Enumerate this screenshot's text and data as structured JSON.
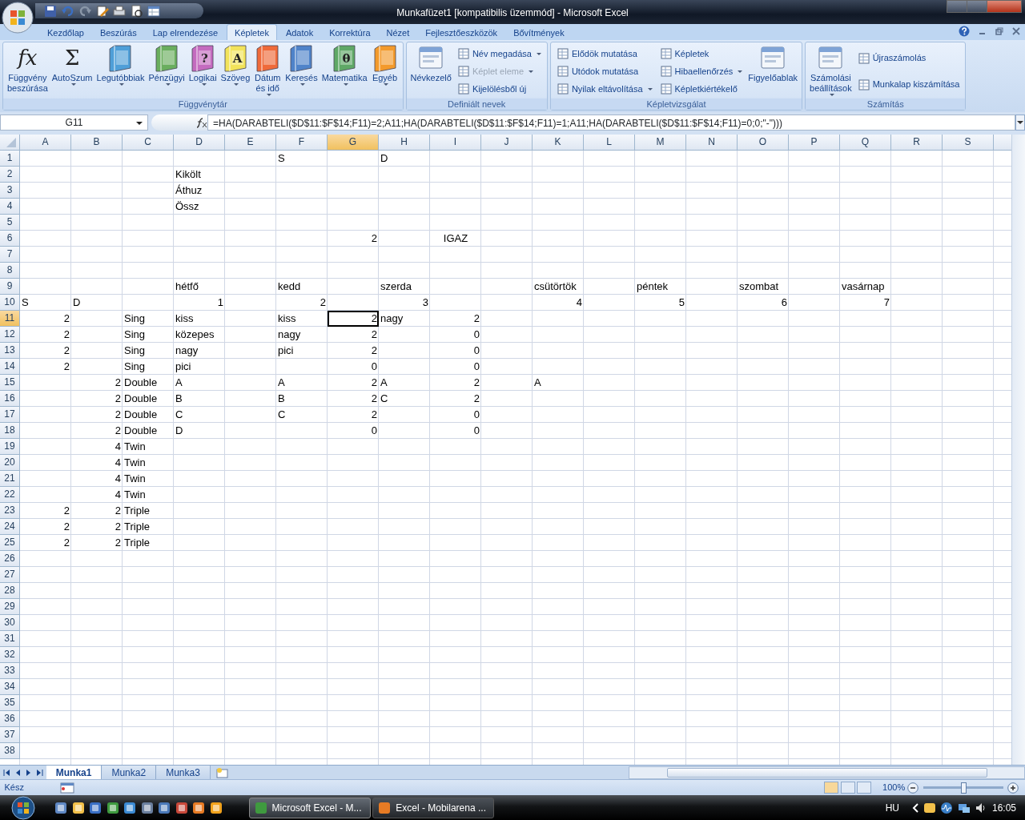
{
  "window": {
    "title": "Munkafüzet1  [kompatibilis üzemmód] - Microsoft Excel"
  },
  "ribbon_tabs": [
    {
      "label": "Kezdőlap",
      "selected": false
    },
    {
      "label": "Beszúrás",
      "selected": false
    },
    {
      "label": "Lap elrendezése",
      "selected": false
    },
    {
      "label": "Képletek",
      "selected": true
    },
    {
      "label": "Adatok",
      "selected": false
    },
    {
      "label": "Korrektúra",
      "selected": false
    },
    {
      "label": "Nézet",
      "selected": false
    },
    {
      "label": "Fejlesztőeszközök",
      "selected": false
    },
    {
      "label": "Bővítmények",
      "selected": false
    }
  ],
  "ribbon_groups": [
    {
      "label": "Függvénytár",
      "items": [
        {
          "kind": "large",
          "label": "Függvény\nbeszúrása",
          "glyph": "fx",
          "dropdown": false,
          "disabled": false
        },
        {
          "kind": "large",
          "label": "AutoSzum",
          "glyph": "Σ",
          "dropdown": true,
          "disabled": false
        },
        {
          "kind": "large",
          "label": "Legutóbbiak",
          "color": "#4f9fd8",
          "dropdown": true,
          "disabled": false
        },
        {
          "kind": "large",
          "label": "Pénzügyi",
          "color": "#6aae5e",
          "dropdown": true,
          "disabled": false
        },
        {
          "kind": "large",
          "label": "Logikai",
          "color": "#c46bbf",
          "glyph": "?",
          "dropdown": true,
          "disabled": false
        },
        {
          "kind": "large",
          "label": "Szöveg",
          "color": "#f2e35a",
          "glyph": "A",
          "dropdown": true,
          "disabled": false
        },
        {
          "kind": "large",
          "label": "Dátum\nés idő",
          "color": "#ef6a3a",
          "dropdown": true,
          "disabled": false
        },
        {
          "kind": "large",
          "label": "Keresés",
          "color": "#4f83c9",
          "dropdown": true,
          "disabled": false
        },
        {
          "kind": "large",
          "label": "Matematika",
          "color": "#5fa866",
          "glyph": "θ",
          "dropdown": true,
          "disabled": false
        },
        {
          "kind": "large",
          "label": "Egyéb",
          "color": "#f39a2c",
          "dropdown": true,
          "disabled": false
        }
      ]
    },
    {
      "label": "Definiált nevek",
      "items": [
        {
          "kind": "large",
          "label": "Névkezelő",
          "dropdown": false,
          "disabled": false
        },
        {
          "kind": "small",
          "label": "Név megadása",
          "dropdown": true,
          "disabled": false
        },
        {
          "kind": "small",
          "label": "Képlet eleme",
          "dropdown": true,
          "disabled": true
        },
        {
          "kind": "small",
          "label": "Kijelölésből új",
          "dropdown": false,
          "disabled": false
        }
      ]
    },
    {
      "label": "Képletvizsgálat",
      "items": [
        {
          "kind": "small",
          "label": "Elődök mutatása",
          "dropdown": false,
          "disabled": false
        },
        {
          "kind": "small",
          "label": "Utódok mutatása",
          "dropdown": false,
          "disabled": false
        },
        {
          "kind": "small",
          "label": "Nyilak eltávolítása",
          "dropdown": true,
          "disabled": false
        },
        {
          "kind": "small",
          "label": "Képletek",
          "dropdown": false,
          "disabled": false
        },
        {
          "kind": "small",
          "label": "Hibaellenőrzés",
          "dropdown": true,
          "disabled": false
        },
        {
          "kind": "small",
          "label": "Képletkiértékelő",
          "dropdown": false,
          "disabled": false
        },
        {
          "kind": "large",
          "label": "Figyelőablak",
          "dropdown": false,
          "disabled": false
        }
      ]
    },
    {
      "label": "Számítás",
      "items": [
        {
          "kind": "large",
          "label": "Számolási\nbeállítások",
          "dropdown": true,
          "disabled": false
        },
        {
          "kind": "small",
          "label": "Újraszámolás",
          "dropdown": false,
          "disabled": false
        },
        {
          "kind": "small",
          "label": "Munkalap kiszámítása",
          "dropdown": false,
          "disabled": false
        }
      ]
    }
  ],
  "formula_bar": {
    "name_box": "G11",
    "formula": "=HA(DARABTELI($D$11:$F$14;F11)=2;A11;HA(DARABTELI($D$11:$F$14;F11)=1;A11;HA(DARABTELI($D$11:$F$14;F11)=0;0;\"-\")))"
  },
  "columns": [
    {
      "label": "A",
      "selected": false
    },
    {
      "label": "B",
      "selected": false
    },
    {
      "label": "C",
      "selected": false
    },
    {
      "label": "D",
      "selected": false
    },
    {
      "label": "E",
      "selected": false
    },
    {
      "label": "F",
      "selected": false
    },
    {
      "label": "G",
      "selected": true
    },
    {
      "label": "H",
      "selected": false
    },
    {
      "label": "I",
      "selected": false
    },
    {
      "label": "J",
      "selected": false
    },
    {
      "label": "K",
      "selected": false
    },
    {
      "label": "L",
      "selected": false
    },
    {
      "label": "M",
      "selected": false
    },
    {
      "label": "N",
      "selected": false
    },
    {
      "label": "O",
      "selected": false
    },
    {
      "label": "P",
      "selected": false
    },
    {
      "label": "Q",
      "selected": false
    },
    {
      "label": "R",
      "selected": false
    },
    {
      "label": "S",
      "selected": false
    }
  ],
  "rows": [
    {
      "number": "1",
      "selected": false,
      "cells": {
        "F": {
          "value": "S",
          "numeric": false,
          "logical": false
        },
        "H": {
          "value": "D",
          "numeric": false,
          "logical": false
        }
      }
    },
    {
      "number": "2",
      "selected": false,
      "cells": {
        "D": {
          "value": "Kikölt",
          "numeric": false,
          "logical": false
        }
      }
    },
    {
      "number": "3",
      "selected": false,
      "cells": {
        "D": {
          "value": "Áthuz",
          "numeric": false,
          "logical": false
        }
      }
    },
    {
      "number": "4",
      "selected": false,
      "cells": {
        "D": {
          "value": "Össz",
          "numeric": false,
          "logical": false
        }
      }
    },
    {
      "number": "5",
      "selected": false
    },
    {
      "number": "6",
      "selected": false,
      "cells": {
        "G": {
          "value": "2",
          "numeric": true,
          "logical": false
        },
        "I": {
          "value": "IGAZ",
          "numeric": false,
          "logical": true
        }
      }
    },
    {
      "number": "7",
      "selected": false
    },
    {
      "number": "8",
      "selected": false
    },
    {
      "number": "9",
      "selected": false,
      "cells": {
        "D": {
          "value": "hétfő",
          "numeric": false,
          "logical": false
        },
        "F": {
          "value": "kedd",
          "numeric": false,
          "logical": false
        },
        "H": {
          "value": "szerda",
          "numeric": false,
          "logical": false
        },
        "K": {
          "value": "csütörtök",
          "numeric": false,
          "logical": false
        },
        "M": {
          "value": "péntek",
          "numeric": false,
          "logical": false
        },
        "O": {
          "value": "szombat",
          "numeric": false,
          "logical": false
        },
        "Q": {
          "value": "vasárnap",
          "numeric": false,
          "logical": false
        }
      }
    },
    {
      "number": "10",
      "selected": false,
      "cells": {
        "A": {
          "value": "S",
          "numeric": false,
          "logical": false
        },
        "B": {
          "value": "D",
          "numeric": false,
          "logical": false
        },
        "D": {
          "value": "1",
          "numeric": true,
          "logical": false
        },
        "F": {
          "value": "2",
          "numeric": true,
          "logical": false
        },
        "H": {
          "value": "3",
          "numeric": true,
          "logical": false
        },
        "K": {
          "value": "4",
          "numeric": true,
          "logical": false
        },
        "M": {
          "value": "5",
          "numeric": true,
          "logical": false
        },
        "O": {
          "value": "6",
          "numeric": true,
          "logical": false
        },
        "Q": {
          "value": "7",
          "numeric": true,
          "logical": false
        }
      }
    },
    {
      "number": "11",
      "selected": true,
      "cells": {
        "A": {
          "value": "2",
          "numeric": true,
          "logical": false
        },
        "C": {
          "value": "Sing",
          "numeric": false,
          "logical": false
        },
        "D": {
          "value": "kiss",
          "numeric": false,
          "logical": false
        },
        "F": {
          "value": "kiss",
          "numeric": false,
          "logical": false
        },
        "G": {
          "value": "2",
          "numeric": true,
          "logical": false
        },
        "H": {
          "value": "nagy",
          "numeric": false,
          "logical": false
        },
        "I": {
          "value": "2",
          "numeric": true,
          "logical": false
        }
      }
    },
    {
      "number": "12",
      "selected": false,
      "cells": {
        "A": {
          "value": "2",
          "numeric": true,
          "logical": false
        },
        "C": {
          "value": "Sing",
          "numeric": false,
          "logical": false
        },
        "D": {
          "value": "közepes",
          "numeric": false,
          "logical": false
        },
        "F": {
          "value": "nagy",
          "numeric": false,
          "logical": false
        },
        "G": {
          "value": "2",
          "numeric": true,
          "logical": false
        },
        "I": {
          "value": "0",
          "numeric": true,
          "logical": false
        }
      }
    },
    {
      "number": "13",
      "selected": false,
      "cells": {
        "A": {
          "value": "2",
          "numeric": true,
          "logical": false
        },
        "C": {
          "value": "Sing",
          "numeric": false,
          "logical": false
        },
        "D": {
          "value": "nagy",
          "numeric": false,
          "logical": false
        },
        "F": {
          "value": "pici",
          "numeric": false,
          "logical": false
        },
        "G": {
          "value": "2",
          "numeric": true,
          "logical": false
        },
        "I": {
          "value": "0",
          "numeric": true,
          "logical": false
        }
      }
    },
    {
      "number": "14",
      "selected": false,
      "cells": {
        "A": {
          "value": "2",
          "numeric": true,
          "logical": false
        },
        "C": {
          "value": "Sing",
          "numeric": false,
          "logical": false
        },
        "D": {
          "value": "pici",
          "numeric": false,
          "logical": false
        },
        "G": {
          "value": "0",
          "numeric": true,
          "logical": false
        },
        "I": {
          "value": "0",
          "numeric": true,
          "logical": false
        }
      }
    },
    {
      "number": "15",
      "selected": false,
      "cells": {
        "B": {
          "value": "2",
          "numeric": true,
          "logical": false
        },
        "C": {
          "value": "Double",
          "numeric": false,
          "logical": false
        },
        "D": {
          "value": "A",
          "numeric": false,
          "logical": false
        },
        "F": {
          "value": "A",
          "numeric": false,
          "logical": false
        },
        "G": {
          "value": "2",
          "numeric": true,
          "logical": false
        },
        "H": {
          "value": "A",
          "numeric": false,
          "logical": false
        },
        "I": {
          "value": "2",
          "numeric": true,
          "logical": false
        },
        "K": {
          "value": "A",
          "numeric": false,
          "logical": false
        }
      }
    },
    {
      "number": "16",
      "selected": false,
      "cells": {
        "B": {
          "value": "2",
          "numeric": true,
          "logical": false
        },
        "C": {
          "value": "Double",
          "numeric": false,
          "logical": false
        },
        "D": {
          "value": "B",
          "numeric": false,
          "logical": false
        },
        "F": {
          "value": "B",
          "numeric": false,
          "logical": false
        },
        "G": {
          "value": "2",
          "numeric": true,
          "logical": false
        },
        "H": {
          "value": "C",
          "numeric": false,
          "logical": false
        },
        "I": {
          "value": "2",
          "numeric": true,
          "logical": false
        }
      }
    },
    {
      "number": "17",
      "selected": false,
      "cells": {
        "B": {
          "value": "2",
          "numeric": true,
          "logical": false
        },
        "C": {
          "value": "Double",
          "numeric": false,
          "logical": false
        },
        "D": {
          "value": "C",
          "numeric": false,
          "logical": false
        },
        "F": {
          "value": "C",
          "numeric": false,
          "logical": false
        },
        "G": {
          "value": "2",
          "numeric": true,
          "logical": false
        },
        "I": {
          "value": "0",
          "numeric": true,
          "logical": false
        }
      }
    },
    {
      "number": "18",
      "selected": false,
      "cells": {
        "B": {
          "value": "2",
          "numeric": true,
          "logical": false
        },
        "C": {
          "value": "Double",
          "numeric": false,
          "logical": false
        },
        "D": {
          "value": "D",
          "numeric": false,
          "logical": false
        },
        "G": {
          "value": "0",
          "numeric": true,
          "logical": false
        },
        "I": {
          "value": "0",
          "numeric": true,
          "logical": false
        }
      }
    },
    {
      "number": "19",
      "selected": false,
      "cells": {
        "B": {
          "value": "4",
          "numeric": true,
          "logical": false
        },
        "C": {
          "value": "Twin",
          "numeric": false,
          "logical": false
        }
      }
    },
    {
      "number": "20",
      "selected": false,
      "cells": {
        "B": {
          "value": "4",
          "numeric": true,
          "logical": false
        },
        "C": {
          "value": "Twin",
          "numeric": false,
          "logical": false
        }
      }
    },
    {
      "number": "21",
      "selected": false,
      "cells": {
        "B": {
          "value": "4",
          "numeric": true,
          "logical": false
        },
        "C": {
          "value": "Twin",
          "numeric": false,
          "logical": false
        }
      }
    },
    {
      "number": "22",
      "selected": false,
      "cells": {
        "B": {
          "value": "4",
          "numeric": true,
          "logical": false
        },
        "C": {
          "value": "Twin",
          "numeric": false,
          "logical": false
        }
      }
    },
    {
      "number": "23",
      "selected": false,
      "cells": {
        "A": {
          "value": "2",
          "numeric": true,
          "logical": false
        },
        "B": {
          "value": "2",
          "numeric": true,
          "logical": false
        },
        "C": {
          "value": "Triple",
          "numeric": false,
          "logical": false
        }
      }
    },
    {
      "number": "24",
      "selected": false,
      "cells": {
        "A": {
          "value": "2",
          "numeric": true,
          "logical": false
        },
        "B": {
          "value": "2",
          "numeric": true,
          "logical": false
        },
        "C": {
          "value": "Triple",
          "numeric": false,
          "logical": false
        }
      }
    },
    {
      "number": "25",
      "selected": false,
      "cells": {
        "A": {
          "value": "2",
          "numeric": true,
          "logical": false
        },
        "B": {
          "value": "2",
          "numeric": true,
          "logical": false
        },
        "C": {
          "value": "Triple",
          "numeric": false,
          "logical": false
        }
      }
    },
    {
      "number": "26",
      "selected": false
    },
    {
      "number": "27",
      "selected": false
    },
    {
      "number": "28",
      "selected": false
    },
    {
      "number": "29",
      "selected": false
    },
    {
      "number": "30",
      "selected": false
    },
    {
      "number": "31",
      "selected": false
    },
    {
      "number": "32",
      "selected": false
    },
    {
      "number": "33",
      "selected": false
    },
    {
      "number": "34",
      "selected": false
    },
    {
      "number": "35",
      "selected": false
    },
    {
      "number": "36",
      "selected": false
    },
    {
      "number": "37",
      "selected": false
    },
    {
      "number": "38",
      "selected": false
    }
  ],
  "sheet_tabs": [
    {
      "label": "Munka1",
      "selected": true
    },
    {
      "label": "Munka2",
      "selected": false
    },
    {
      "label": "Munka3",
      "selected": false
    }
  ],
  "status_bar": {
    "text": "Kész",
    "views": [
      {
        "selected": true
      },
      {
        "selected": false
      },
      {
        "selected": false
      }
    ],
    "zoom": {
      "label": "100%",
      "level": 0.5
    }
  },
  "taskbar": {
    "tasks": [
      {
        "label": "Microsoft Excel - M...",
        "selected": true
      },
      {
        "label": "Excel - Mobilarena ...",
        "selected": false
      }
    ],
    "language": "HU",
    "clock": "16:05"
  }
}
